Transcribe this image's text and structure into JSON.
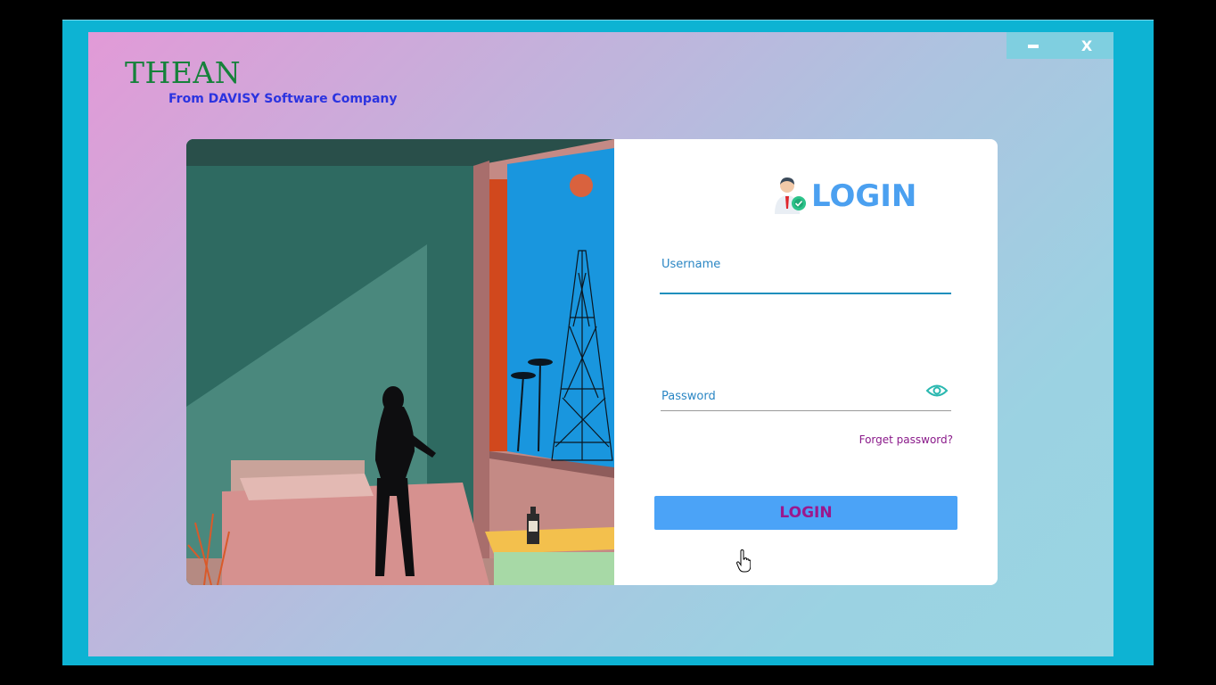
{
  "window": {
    "minimize_label": "",
    "close_label": "X",
    "frame_color": "#0db3d3"
  },
  "brand": {
    "title": "THEAN",
    "subtitle": "From DAVISY Software Company",
    "title_color": "#15813a",
    "subtitle_color": "#2b33e0"
  },
  "login": {
    "heading": "LOGIN",
    "username_label": "Username",
    "username_value": "",
    "password_label": "Password",
    "password_value": "",
    "forget_password": "Forget password?",
    "submit_label": "LOGIN",
    "accent_color": "#4ba3f7",
    "button_text_color": "#9b188d"
  },
  "icons": {
    "user_icon": "user-badge-icon",
    "eye_icon": "eye-icon",
    "cursor": "hand-pointer-cursor"
  }
}
